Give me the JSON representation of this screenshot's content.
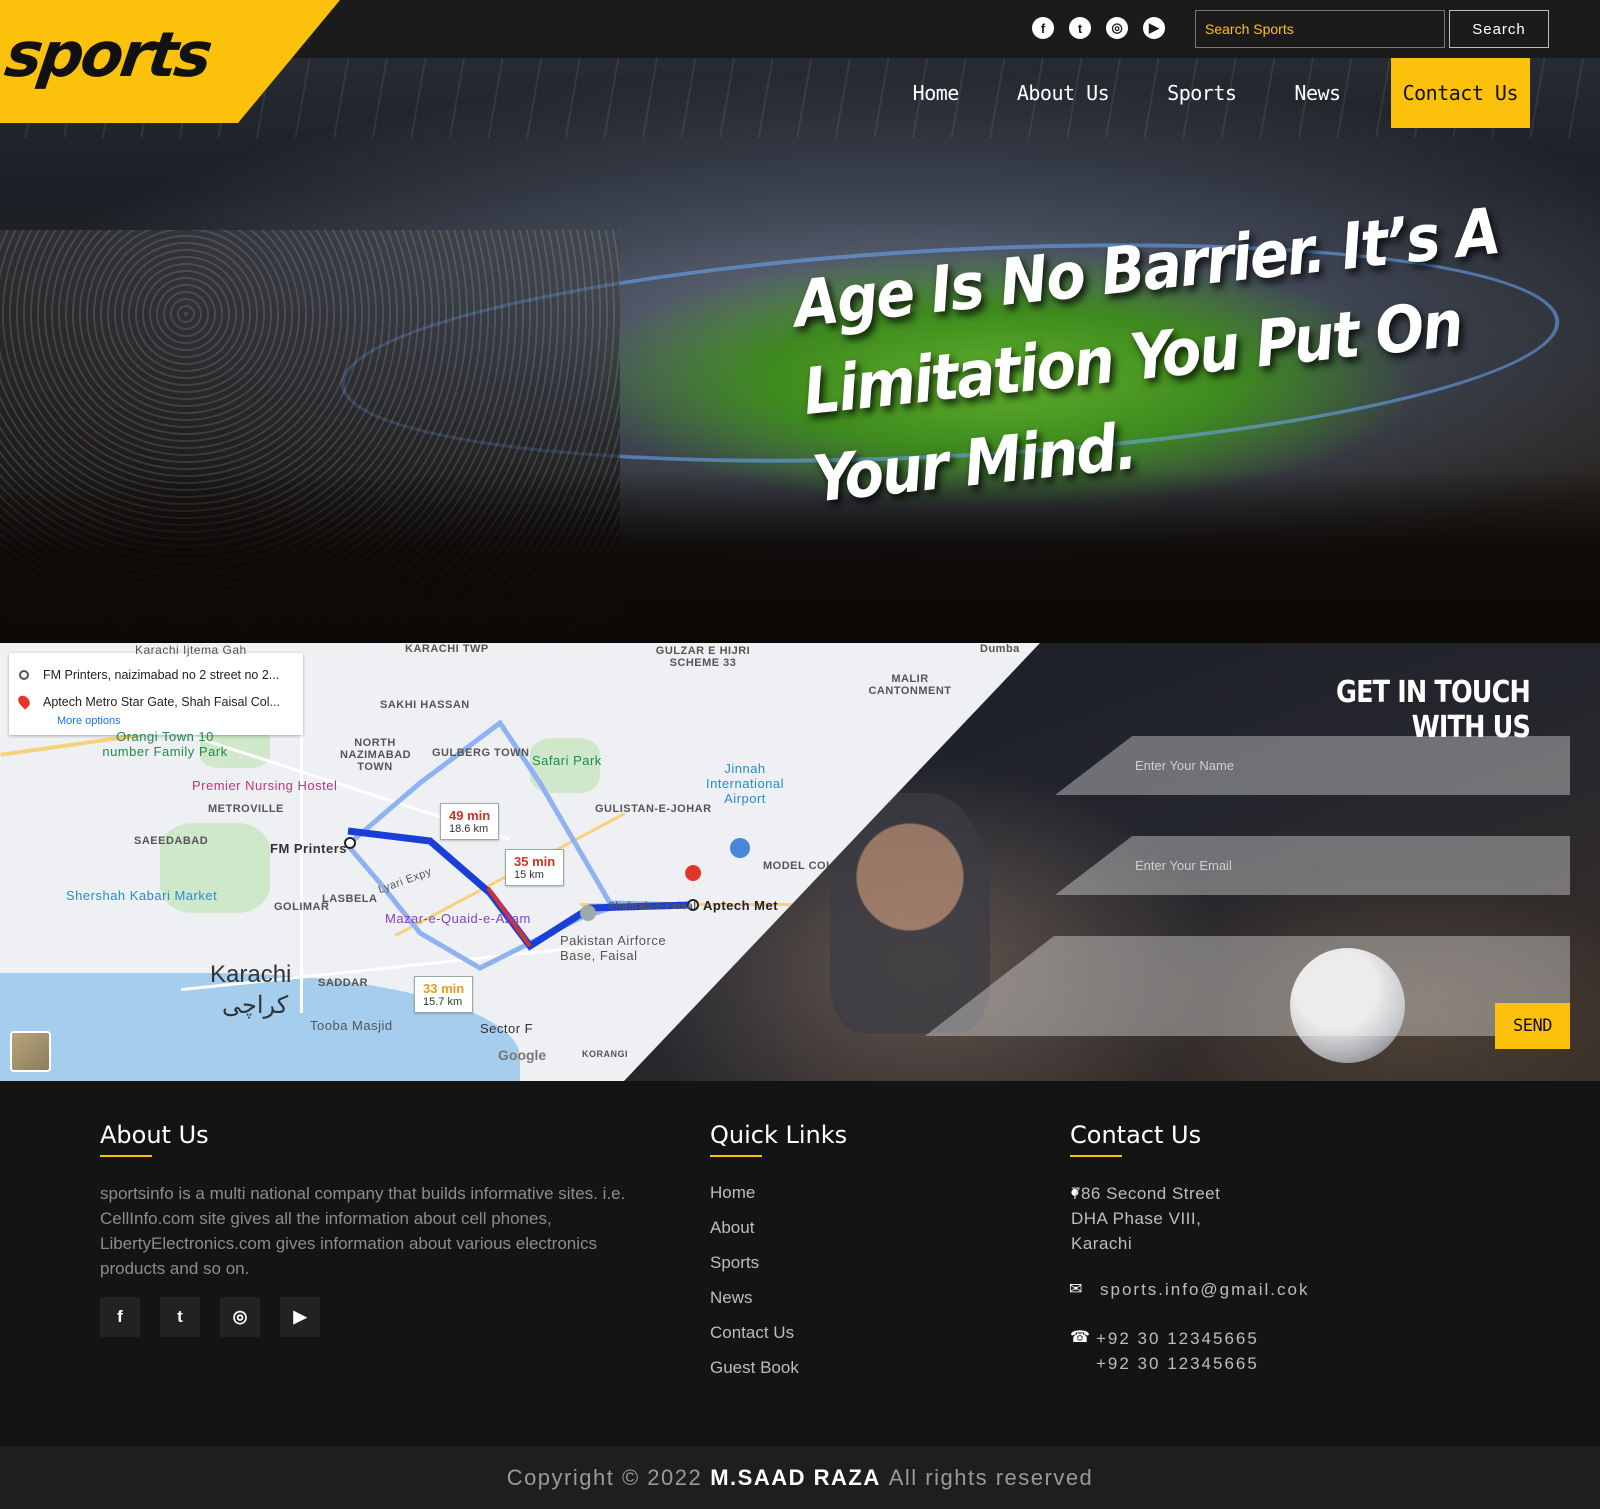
{
  "brand": {
    "logo": "sports",
    "accent": "#fcc10a"
  },
  "social": [
    "facebook-icon",
    "twitter-icon",
    "instagram-icon",
    "youtube-icon"
  ],
  "search": {
    "placeholder": "Search Sports",
    "button": "Search"
  },
  "nav": [
    {
      "label": "Home"
    },
    {
      "label": "About Us"
    },
    {
      "label": "Sports"
    },
    {
      "label": "News"
    },
    {
      "label": "Contact Us",
      "active": true
    }
  ],
  "hero": {
    "quote": "Age Is No Barrier. It’s A Limitation You Put On Your Mind."
  },
  "map": {
    "origin": "FM Printers, naizimabad no 2 street no 2...",
    "destination": "Aptech Metro Star Gate, Shah Faisal Col...",
    "more_options": "More options",
    "routes": [
      {
        "time": "49 min",
        "distance": "18.6 km"
      },
      {
        "time": "35 min",
        "distance": "15 km"
      },
      {
        "time": "33 min",
        "distance": "15.7 km"
      }
    ],
    "labels": {
      "karachi": "Karachi",
      "karachi_urdu": "کراچی",
      "fm_printers": "FM Printers",
      "aptech": "Aptech Met",
      "gulzar": "GULZAR E HIJRI SCHEME 33",
      "malir": "MALIR CANTONMENT",
      "saeedabad": "SAEEDABAD",
      "metroville": "METROVILLE",
      "north_nazimabad": "NORTH NAZIMABAD TOWN",
      "gulberg": "GULBERG TOWN",
      "sakhi": "SAKHI HASSAN",
      "gulistan": "GULISTAN-E-JOHAR",
      "safari": "Safari Park",
      "jinnah": "Jinnah International Airport",
      "premier": "Premier Nursing Hostel",
      "orangi": "Orangi Town 10 number Family Park",
      "shershah": "Shershah Kabari Market",
      "mazar": "Mazar-e-Quaid-e-Azam",
      "faisal": "Pakistan Airforce Base, Faisal",
      "tooba": "Tooba Masjid",
      "saddar": "SADDAR",
      "golimar": "GOLIMAR",
      "lasbela": "LASBELA",
      "sector": "Sector F",
      "google": "Google",
      "korangi": "KORANGI",
      "karachi_ijtema": "Karachi Ijtema Gah",
      "karachi_twp": "KARACHI TWP",
      "model": "MODEL COL",
      "dumba": "Dumba",
      "lyari": "Lyari Expy",
      "shahrah": "Shahrah-e-Faisal"
    }
  },
  "contact_form": {
    "title": "GET IN TOUCH WITH US",
    "name_placeholder": "Enter Your Name",
    "email_placeholder": "Enter Your Email",
    "send": "SEND"
  },
  "footer": {
    "about": {
      "title": "About Us",
      "text": "sportsinfo is a multi national company that builds informative sites. i.e. CellInfo.com site gives all the information about cell phones, LibertyElectronics.com gives information about various electronics products and so on."
    },
    "quick_links": {
      "title": "Quick Links",
      "items": [
        "Home",
        "About",
        "Sports",
        "News",
        "Contact Us",
        "Guest Book"
      ]
    },
    "contact": {
      "title": "Contact Us",
      "address_1": "786 Second Street",
      "address_2": "DHA Phase VIII,",
      "address_3": "Karachi",
      "email": "sports.info@gmail.cok",
      "phone_1": "+92 30 12345665",
      "phone_2": "+92 30 12345665"
    }
  },
  "copyright": {
    "prefix": "Copyright © 2022",
    "name": "M.SAAD RAZA",
    "suffix": "All rights reserved"
  }
}
